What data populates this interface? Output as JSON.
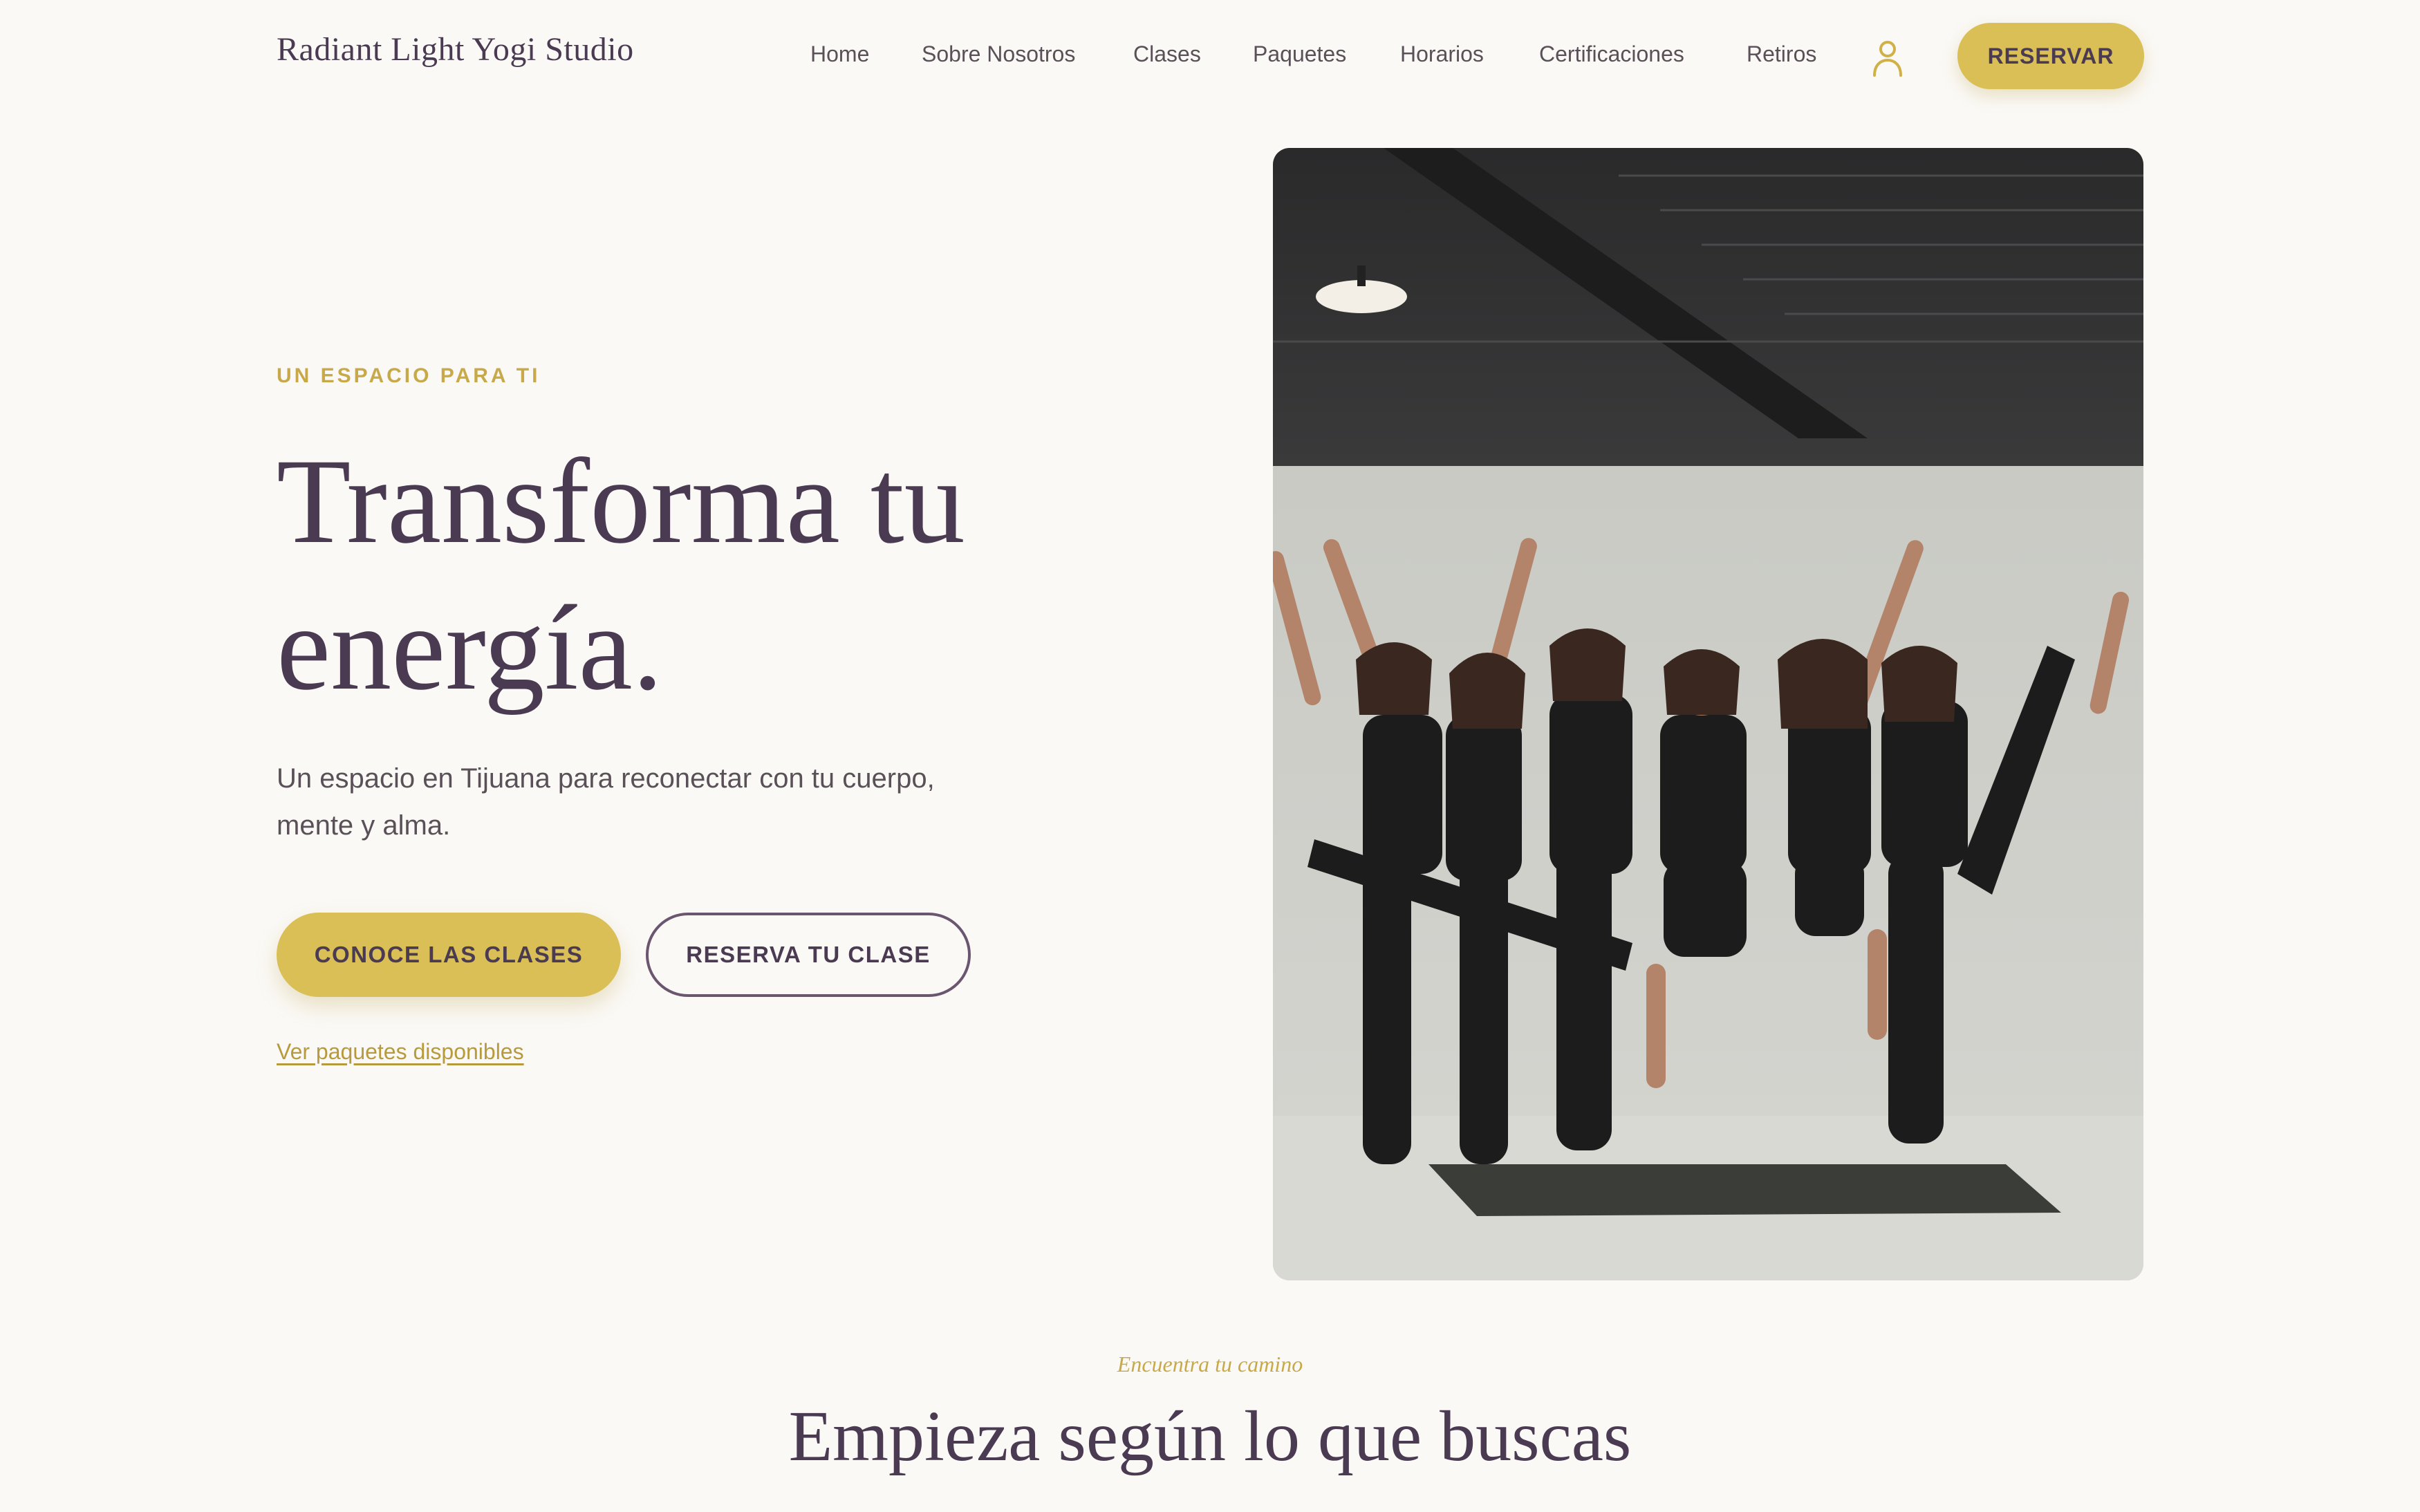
{
  "header": {
    "brand": "Radiant Light Yogi Studio",
    "nav": [
      {
        "label": "Home"
      },
      {
        "label": "Sobre Nosotros"
      },
      {
        "label": "Clases"
      },
      {
        "label": "Paquetes"
      },
      {
        "label": "Horarios"
      },
      {
        "label": "Certificaciones"
      },
      {
        "label": "Retiros"
      }
    ],
    "account_icon": "user-icon",
    "cta_label": "RESERVAR"
  },
  "hero": {
    "eyebrow": "UN ESPACIO PARA TI",
    "title_line1": "Transforma tu",
    "title_line2": "energía.",
    "subtitle": "Un espacio en Tijuana para reconectar con tu cuerpo, mente y alma.",
    "primary_cta": "CONOCE LAS CLASES",
    "secondary_cta": "RESERVA TU CLASE",
    "link": "Ver paquetes disponibles",
    "photo_icon": "group-yoga-photo"
  },
  "section": {
    "kicker": "Encuentra tu camino",
    "title": "Empieza según lo que buscas"
  },
  "colors": {
    "background": "#fbf9f6",
    "accent_gold": "#d9bf55",
    "text_plum": "#4a3b52"
  }
}
